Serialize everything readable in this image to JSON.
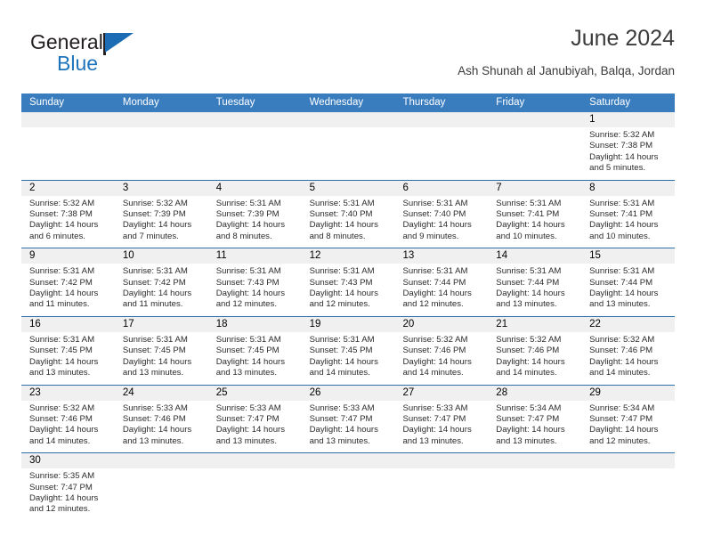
{
  "logo": {
    "primary_text": "General",
    "secondary_text": "Blue",
    "primary_color": "#231f20",
    "secondary_color": "#1e74bb",
    "flag_color": "#1b6cb4"
  },
  "header": {
    "title": "June 2024",
    "location": "Ash Shunah al Janubiyah, Balqa, Jordan"
  },
  "theme": {
    "header_bg": "#3a7dbf",
    "header_text": "#ffffff",
    "row_divider": "#2f6fa8",
    "daynum_band": "#f0f0f0"
  },
  "weekdays": [
    "Sunday",
    "Monday",
    "Tuesday",
    "Wednesday",
    "Thursday",
    "Friday",
    "Saturday"
  ],
  "weeks": [
    [
      {
        "blank": true
      },
      {
        "blank": true
      },
      {
        "blank": true
      },
      {
        "blank": true
      },
      {
        "blank": true
      },
      {
        "blank": true
      },
      {
        "day": "1",
        "sunrise": "Sunrise: 5:32 AM",
        "sunset": "Sunset: 7:38 PM",
        "daylight_1": "Daylight: 14 hours",
        "daylight_2": "and 5 minutes."
      }
    ],
    [
      {
        "day": "2",
        "sunrise": "Sunrise: 5:32 AM",
        "sunset": "Sunset: 7:38 PM",
        "daylight_1": "Daylight: 14 hours",
        "daylight_2": "and 6 minutes."
      },
      {
        "day": "3",
        "sunrise": "Sunrise: 5:32 AM",
        "sunset": "Sunset: 7:39 PM",
        "daylight_1": "Daylight: 14 hours",
        "daylight_2": "and 7 minutes."
      },
      {
        "day": "4",
        "sunrise": "Sunrise: 5:31 AM",
        "sunset": "Sunset: 7:39 PM",
        "daylight_1": "Daylight: 14 hours",
        "daylight_2": "and 8 minutes."
      },
      {
        "day": "5",
        "sunrise": "Sunrise: 5:31 AM",
        "sunset": "Sunset: 7:40 PM",
        "daylight_1": "Daylight: 14 hours",
        "daylight_2": "and 8 minutes."
      },
      {
        "day": "6",
        "sunrise": "Sunrise: 5:31 AM",
        "sunset": "Sunset: 7:40 PM",
        "daylight_1": "Daylight: 14 hours",
        "daylight_2": "and 9 minutes."
      },
      {
        "day": "7",
        "sunrise": "Sunrise: 5:31 AM",
        "sunset": "Sunset: 7:41 PM",
        "daylight_1": "Daylight: 14 hours",
        "daylight_2": "and 10 minutes."
      },
      {
        "day": "8",
        "sunrise": "Sunrise: 5:31 AM",
        "sunset": "Sunset: 7:41 PM",
        "daylight_1": "Daylight: 14 hours",
        "daylight_2": "and 10 minutes."
      }
    ],
    [
      {
        "day": "9",
        "sunrise": "Sunrise: 5:31 AM",
        "sunset": "Sunset: 7:42 PM",
        "daylight_1": "Daylight: 14 hours",
        "daylight_2": "and 11 minutes."
      },
      {
        "day": "10",
        "sunrise": "Sunrise: 5:31 AM",
        "sunset": "Sunset: 7:42 PM",
        "daylight_1": "Daylight: 14 hours",
        "daylight_2": "and 11 minutes."
      },
      {
        "day": "11",
        "sunrise": "Sunrise: 5:31 AM",
        "sunset": "Sunset: 7:43 PM",
        "daylight_1": "Daylight: 14 hours",
        "daylight_2": "and 12 minutes."
      },
      {
        "day": "12",
        "sunrise": "Sunrise: 5:31 AM",
        "sunset": "Sunset: 7:43 PM",
        "daylight_1": "Daylight: 14 hours",
        "daylight_2": "and 12 minutes."
      },
      {
        "day": "13",
        "sunrise": "Sunrise: 5:31 AM",
        "sunset": "Sunset: 7:44 PM",
        "daylight_1": "Daylight: 14 hours",
        "daylight_2": "and 12 minutes."
      },
      {
        "day": "14",
        "sunrise": "Sunrise: 5:31 AM",
        "sunset": "Sunset: 7:44 PM",
        "daylight_1": "Daylight: 14 hours",
        "daylight_2": "and 13 minutes."
      },
      {
        "day": "15",
        "sunrise": "Sunrise: 5:31 AM",
        "sunset": "Sunset: 7:44 PM",
        "daylight_1": "Daylight: 14 hours",
        "daylight_2": "and 13 minutes."
      }
    ],
    [
      {
        "day": "16",
        "sunrise": "Sunrise: 5:31 AM",
        "sunset": "Sunset: 7:45 PM",
        "daylight_1": "Daylight: 14 hours",
        "daylight_2": "and 13 minutes."
      },
      {
        "day": "17",
        "sunrise": "Sunrise: 5:31 AM",
        "sunset": "Sunset: 7:45 PM",
        "daylight_1": "Daylight: 14 hours",
        "daylight_2": "and 13 minutes."
      },
      {
        "day": "18",
        "sunrise": "Sunrise: 5:31 AM",
        "sunset": "Sunset: 7:45 PM",
        "daylight_1": "Daylight: 14 hours",
        "daylight_2": "and 13 minutes."
      },
      {
        "day": "19",
        "sunrise": "Sunrise: 5:31 AM",
        "sunset": "Sunset: 7:45 PM",
        "daylight_1": "Daylight: 14 hours",
        "daylight_2": "and 14 minutes."
      },
      {
        "day": "20",
        "sunrise": "Sunrise: 5:32 AM",
        "sunset": "Sunset: 7:46 PM",
        "daylight_1": "Daylight: 14 hours",
        "daylight_2": "and 14 minutes."
      },
      {
        "day": "21",
        "sunrise": "Sunrise: 5:32 AM",
        "sunset": "Sunset: 7:46 PM",
        "daylight_1": "Daylight: 14 hours",
        "daylight_2": "and 14 minutes."
      },
      {
        "day": "22",
        "sunrise": "Sunrise: 5:32 AM",
        "sunset": "Sunset: 7:46 PM",
        "daylight_1": "Daylight: 14 hours",
        "daylight_2": "and 14 minutes."
      }
    ],
    [
      {
        "day": "23",
        "sunrise": "Sunrise: 5:32 AM",
        "sunset": "Sunset: 7:46 PM",
        "daylight_1": "Daylight: 14 hours",
        "daylight_2": "and 14 minutes."
      },
      {
        "day": "24",
        "sunrise": "Sunrise: 5:33 AM",
        "sunset": "Sunset: 7:46 PM",
        "daylight_1": "Daylight: 14 hours",
        "daylight_2": "and 13 minutes."
      },
      {
        "day": "25",
        "sunrise": "Sunrise: 5:33 AM",
        "sunset": "Sunset: 7:47 PM",
        "daylight_1": "Daylight: 14 hours",
        "daylight_2": "and 13 minutes."
      },
      {
        "day": "26",
        "sunrise": "Sunrise: 5:33 AM",
        "sunset": "Sunset: 7:47 PM",
        "daylight_1": "Daylight: 14 hours",
        "daylight_2": "and 13 minutes."
      },
      {
        "day": "27",
        "sunrise": "Sunrise: 5:33 AM",
        "sunset": "Sunset: 7:47 PM",
        "daylight_1": "Daylight: 14 hours",
        "daylight_2": "and 13 minutes."
      },
      {
        "day": "28",
        "sunrise": "Sunrise: 5:34 AM",
        "sunset": "Sunset: 7:47 PM",
        "daylight_1": "Daylight: 14 hours",
        "daylight_2": "and 13 minutes."
      },
      {
        "day": "29",
        "sunrise": "Sunrise: 5:34 AM",
        "sunset": "Sunset: 7:47 PM",
        "daylight_1": "Daylight: 14 hours",
        "daylight_2": "and 12 minutes."
      }
    ],
    [
      {
        "day": "30",
        "sunrise": "Sunrise: 5:35 AM",
        "sunset": "Sunset: 7:47 PM",
        "daylight_1": "Daylight: 14 hours",
        "daylight_2": "and 12 minutes."
      },
      {
        "blank": true
      },
      {
        "blank": true
      },
      {
        "blank": true
      },
      {
        "blank": true
      },
      {
        "blank": true
      },
      {
        "blank": true
      }
    ]
  ]
}
